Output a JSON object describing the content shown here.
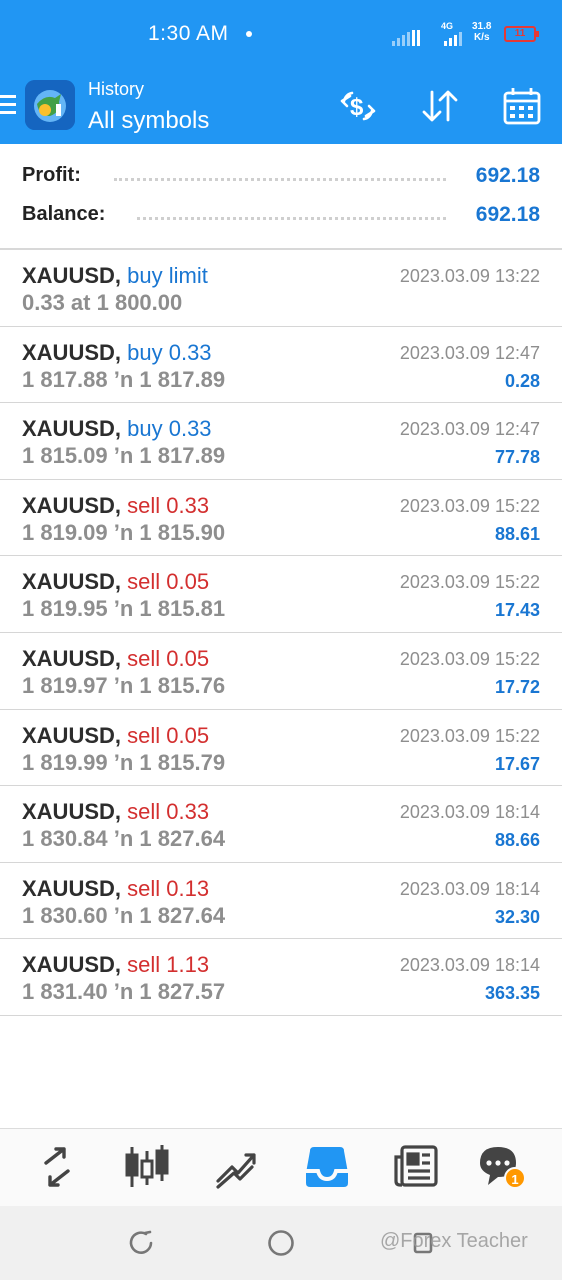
{
  "status_bar": {
    "time": "1:30 AM",
    "network": "4G",
    "speed_value": "31.8",
    "speed_unit": "K/s",
    "battery": "11"
  },
  "header": {
    "section": "History",
    "filter": "All symbols",
    "icons": [
      "menu-icon",
      "currency-exchange-icon",
      "sort-icon",
      "calendar-icon"
    ]
  },
  "summary": {
    "profit_label": "Profit:",
    "profit_value": "692.18",
    "balance_label": "Balance:",
    "balance_value": "692.18"
  },
  "trades": [
    {
      "symbol": "XAUUSD,",
      "side": "buy limit",
      "type": "buy",
      "prices": "0.33 at 1 800.00",
      "date": "2023.03.09 13:22",
      "profit": ""
    },
    {
      "symbol": "XAUUSD,",
      "side": "buy 0.33",
      "type": "buy",
      "prices": "1 817.88 ’n  1 817.89",
      "date": "2023.03.09 12:47",
      "profit": "0.28"
    },
    {
      "symbol": "XAUUSD,",
      "side": "buy 0.33",
      "type": "buy",
      "prices": "1 815.09 ’n  1 817.89",
      "date": "2023.03.09 12:47",
      "profit": "77.78"
    },
    {
      "symbol": "XAUUSD,",
      "side": "sell 0.33",
      "type": "sell",
      "prices": "1 819.09 ’n  1 815.90",
      "date": "2023.03.09 15:22",
      "profit": "88.61"
    },
    {
      "symbol": "XAUUSD,",
      "side": "sell 0.05",
      "type": "sell",
      "prices": "1 819.95 ’n  1 815.81",
      "date": "2023.03.09 15:22",
      "profit": "17.43"
    },
    {
      "symbol": "XAUUSD,",
      "side": "sell 0.05",
      "type": "sell",
      "prices": "1 819.97 ’n  1 815.76",
      "date": "2023.03.09 15:22",
      "profit": "17.72"
    },
    {
      "symbol": "XAUUSD,",
      "side": "sell 0.05",
      "type": "sell",
      "prices": "1 819.99 ’n  1 815.79",
      "date": "2023.03.09 15:22",
      "profit": "17.67"
    },
    {
      "symbol": "XAUUSD,",
      "side": "sell 0.33",
      "type": "sell",
      "prices": "1 830.84 ’n  1 827.64",
      "date": "2023.03.09 18:14",
      "profit": "88.66"
    },
    {
      "symbol": "XAUUSD,",
      "side": "sell 0.13",
      "type": "sell",
      "prices": "1 830.60 ’n  1 827.64",
      "date": "2023.03.09 18:14",
      "profit": "32.30"
    },
    {
      "symbol": "XAUUSD,",
      "side": "sell 1.13",
      "type": "sell",
      "prices": "1 831.40 ’n  1 827.57",
      "date": "2023.03.09 18:14",
      "profit": "363.35"
    }
  ],
  "bottom_nav": {
    "items": [
      "quotes-icon",
      "chart-icon",
      "trade-icon",
      "history-icon",
      "news-icon",
      "messages-icon"
    ],
    "active": "history-icon",
    "messages_badge": "1"
  },
  "system_nav": {
    "icons": [
      "recent-apps-icon",
      "home-icon",
      "back-icon"
    ]
  },
  "watermark": "@Forex Teacher",
  "colors": {
    "accent": "#2196f3",
    "buy": "#1976d2",
    "sell": "#d32f2f",
    "muted": "#8e8e8e",
    "badge": "#ff9800"
  }
}
